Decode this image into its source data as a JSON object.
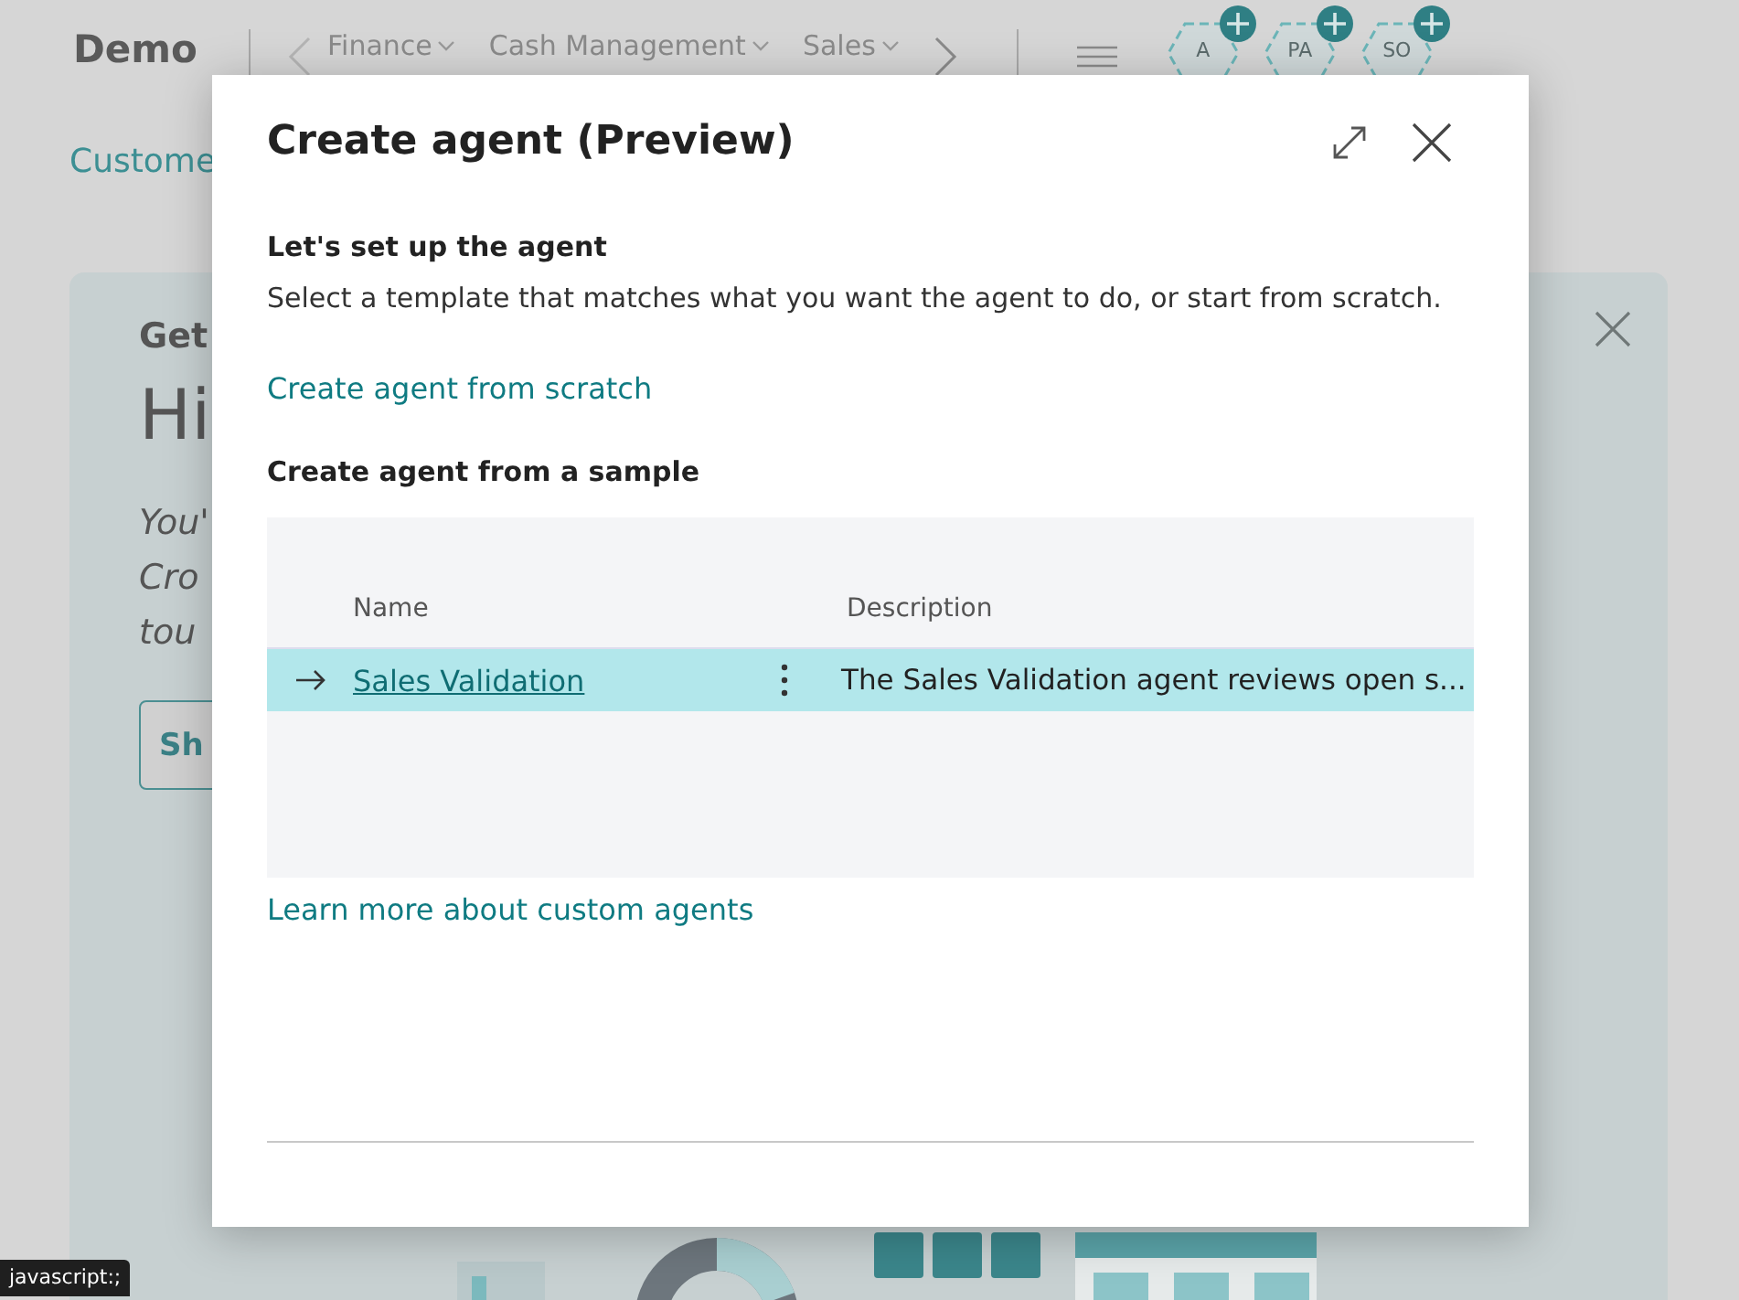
{
  "app": {
    "title": "Demo",
    "breadcrumbs": [
      {
        "label": "Finance"
      },
      {
        "label": "Cash Management"
      },
      {
        "label": "Sales"
      }
    ],
    "avatars": [
      {
        "initials": "A"
      },
      {
        "initials": "PA"
      },
      {
        "initials": "SO"
      }
    ],
    "sub_link": "Custome"
  },
  "card": {
    "heading": "Get",
    "greeting": "Hi",
    "intro_lines": [
      "You'",
      "Cro",
      "tou"
    ],
    "button": "Sh"
  },
  "dialog": {
    "title": "Create agent (Preview)",
    "section_title": "Let's set up the agent",
    "description": "Select a template that matches what you want the agent to do, or start from scratch.",
    "scratch_link": "Create agent from scratch",
    "sample_title": "Create agent from a sample",
    "table": {
      "columns": [
        "Name",
        "Description"
      ],
      "rows": [
        {
          "name": "Sales Validation",
          "description": "The Sales Validation agent reviews open s...",
          "selected": true
        }
      ]
    },
    "learn_link": "Learn more about custom agents"
  },
  "status_tooltip": "javascript:;"
}
